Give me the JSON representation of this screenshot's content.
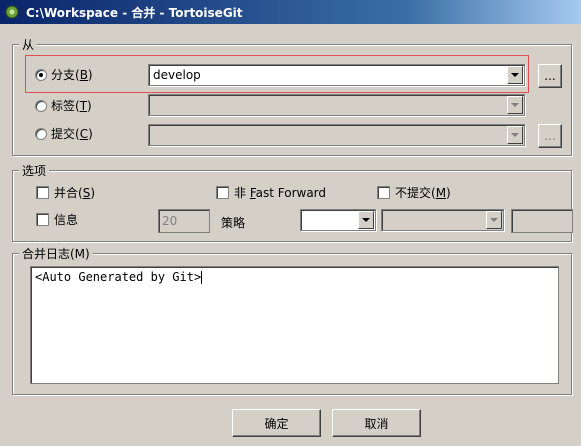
{
  "window": {
    "title": "C:\\Workspace - 合并 - TortoiseGit"
  },
  "from_group": {
    "title": "从",
    "branch": {
      "label": "分支(",
      "key": "B",
      "suffix": ")",
      "value": "develop",
      "checked": true
    },
    "tag": {
      "label": "标签(",
      "key": "T",
      "suffix": ")",
      "checked": false
    },
    "commit": {
      "label": "提交(",
      "key": "C",
      "suffix": ")",
      "checked": false
    },
    "browse_label": "..."
  },
  "options_group": {
    "title": "选项",
    "squash": {
      "label": "并合(",
      "key": "S",
      "suffix": ")"
    },
    "no_ff": {
      "prefix": "非 ",
      "key": "F",
      "label": "ast Forward"
    },
    "no_commit": {
      "label": "不提交(",
      "key": "M",
      "suffix": ")"
    },
    "log": {
      "label": "信息"
    },
    "log_count": "20",
    "strategy_label": "策略"
  },
  "message_group": {
    "title": "合并日志(M)",
    "text": "<Auto Generated by Git>"
  },
  "buttons": {
    "ok": "确定",
    "cancel": "取消"
  }
}
